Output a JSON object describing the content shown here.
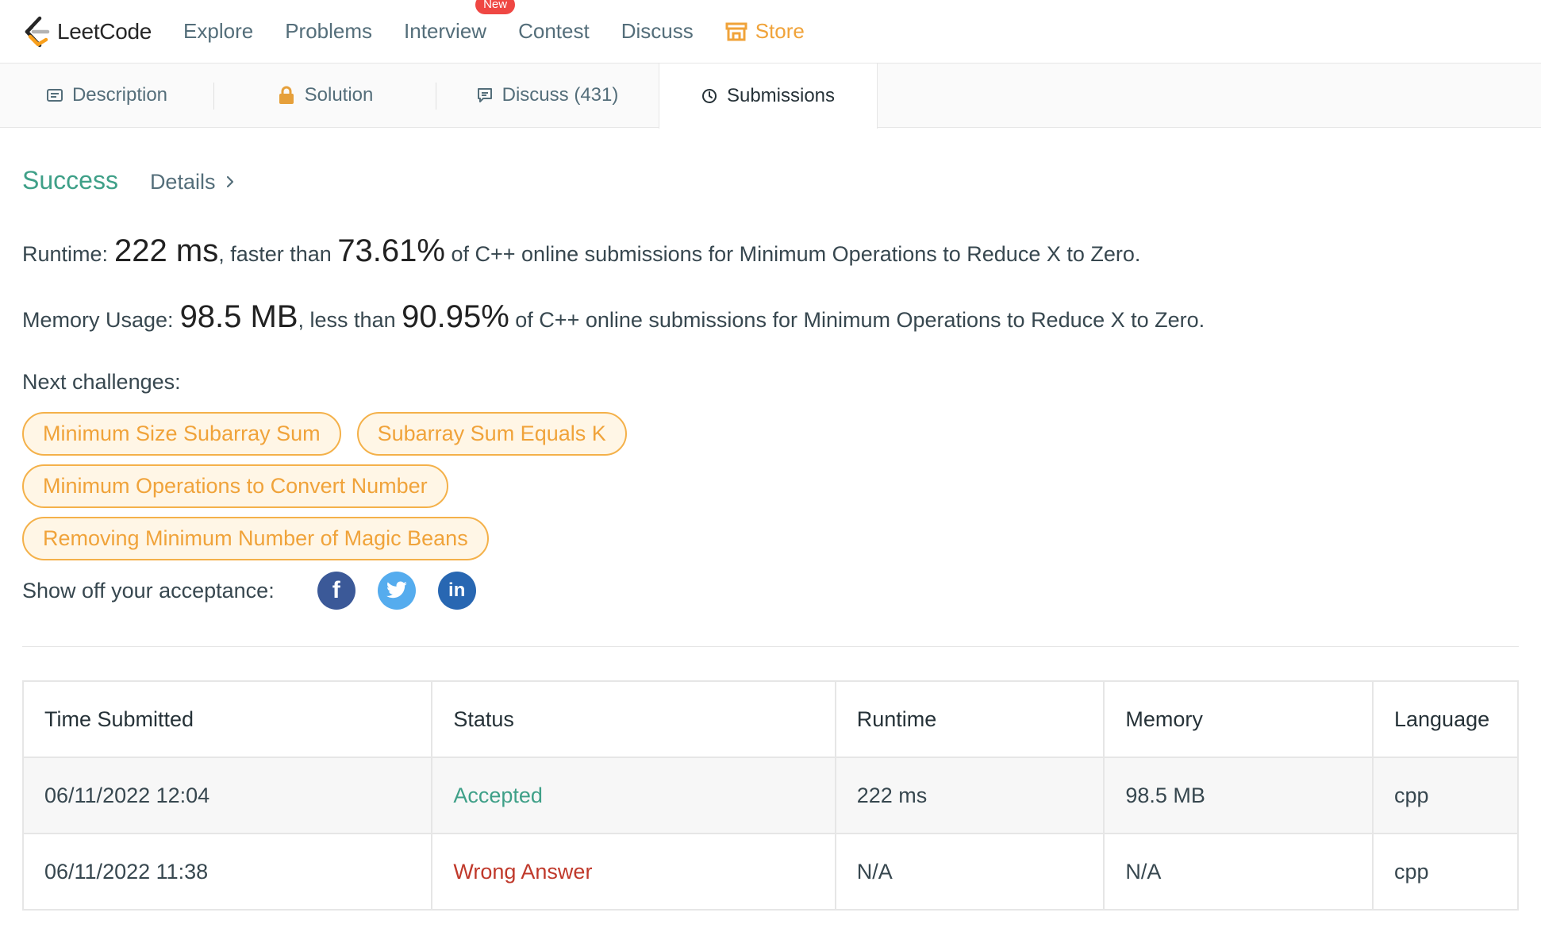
{
  "brand": {
    "name": "LeetCode"
  },
  "nav": {
    "items": [
      "Explore",
      "Problems",
      "Interview",
      "Contest",
      "Discuss"
    ],
    "new_badge": "New",
    "store": "Store"
  },
  "tabs": {
    "description": "Description",
    "solution": "Solution",
    "discuss": "Discuss (431)",
    "submissions": "Submissions"
  },
  "result": {
    "status": "Success",
    "details": "Details",
    "runtime_label": "Runtime: ",
    "runtime_value": "222 ms",
    "runtime_mid": ", faster than ",
    "runtime_pct": "73.61%",
    "runtime_tail": " of C++ online submissions for Minimum Operations to Reduce X to Zero.",
    "memory_label": "Memory Usage: ",
    "memory_value": "98.5 MB",
    "memory_mid": ", less than ",
    "memory_pct": "90.95%",
    "memory_tail": " of C++ online submissions for Minimum Operations to Reduce X to Zero."
  },
  "next": {
    "label": "Next challenges:",
    "challenges": [
      "Minimum Size Subarray Sum",
      "Subarray Sum Equals K",
      "Minimum Operations to Convert Number",
      "Removing Minimum Number of Magic Beans"
    ]
  },
  "share": {
    "label": "Show off your acceptance:",
    "icons": [
      "facebook-icon",
      "twitter-icon",
      "linkedin-icon"
    ]
  },
  "table": {
    "headers": [
      "Time Submitted",
      "Status",
      "Runtime",
      "Memory",
      "Language"
    ],
    "rows": [
      [
        "06/11/2022 12:04",
        "Accepted",
        "222 ms",
        "98.5 MB",
        "cpp"
      ],
      [
        "06/11/2022 11:38",
        "Wrong Answer",
        "N/A",
        "N/A",
        "cpp"
      ]
    ]
  },
  "colors": {
    "success": "#3fa088",
    "store": "#f0a33a",
    "wrong": "#c0392b",
    "badge": "#ef4743"
  }
}
